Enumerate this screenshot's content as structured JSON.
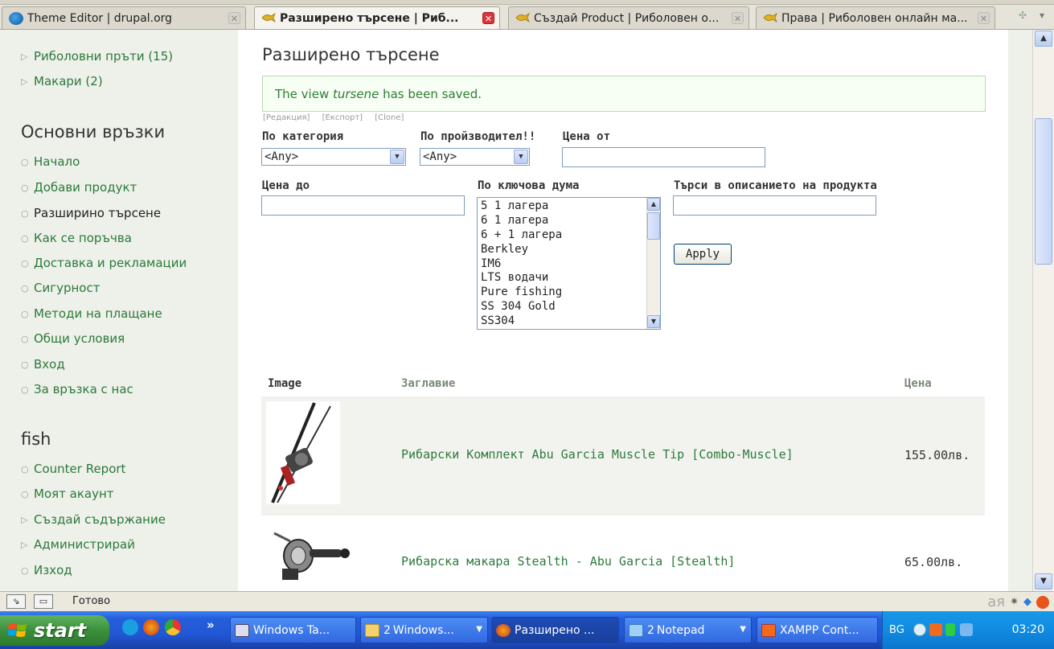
{
  "tabs": [
    {
      "label": "Theme Editor | drupal.org",
      "active": false
    },
    {
      "label": "Разширено търсене | Риб...",
      "active": true
    },
    {
      "label": "Създай Product | Риболовен о...",
      "active": false
    },
    {
      "label": "Права | Риболовен онлайн ма...",
      "active": false
    }
  ],
  "sidebar": {
    "top_items": [
      {
        "label": "Риболовни пръти (15)",
        "bullet": "▷"
      },
      {
        "label": "Макари (2)",
        "bullet": "▷"
      }
    ],
    "main_links_heading": "Основни връзки",
    "main_links": [
      {
        "label": "Начало",
        "active": false
      },
      {
        "label": "Добави продукт",
        "active": false
      },
      {
        "label": "Разширино търсене",
        "active": true
      },
      {
        "label": "Как се поръчва",
        "active": false
      },
      {
        "label": "Доставка и рекламации",
        "active": false
      },
      {
        "label": "Сигурност",
        "active": false
      },
      {
        "label": "Методи на плащане",
        "active": false
      },
      {
        "label": "Общи условия",
        "active": false
      },
      {
        "label": "Вход",
        "active": false
      },
      {
        "label": "За връзка с нас",
        "active": false
      }
    ],
    "user_heading": "fish",
    "user_links": [
      {
        "label": "Counter Report",
        "bullet": "○"
      },
      {
        "label": "Моят акаунт",
        "bullet": "○"
      },
      {
        "label": "Създай съдържание",
        "bullet": "▷"
      },
      {
        "label": "Администрирай",
        "bullet": "▷"
      },
      {
        "label": "Изход",
        "bullet": "○"
      }
    ]
  },
  "main": {
    "title": "Разширено търсене",
    "status_prefix": "The view ",
    "status_view": "tursene",
    "status_suffix": " has been saved.",
    "admin_links": [
      "[Редакция]",
      "[Експорт]",
      "[Clone]"
    ],
    "filters": {
      "category_label": "По категория",
      "category_value": "<Any>",
      "manufacturer_label": "По пройзводител!!",
      "manufacturer_value": "<Any>",
      "price_from_label": "Цена от",
      "price_from_value": "",
      "price_to_label": "Цена до",
      "price_to_value": "",
      "keyword_label": "По ключова дума",
      "keyword_options": [
        "5 1 лагера",
        "6 1 лагера",
        "6 + 1 лагера",
        "Berkley",
        "IM6",
        "LTS водачи",
        "Pure fishing",
        "SS 304 Gold",
        "SS304"
      ],
      "description_label": "Търси в описанието на продукта",
      "description_value": "",
      "apply_label": "Apply"
    },
    "table": {
      "headers": [
        "Image",
        "Заглавие",
        "Цена"
      ],
      "rows": [
        {
          "title": "Рибарски Комплект Abu Garcia Muscle Tip [Combo-Muscle]",
          "price": "155.00лв.",
          "image": "fishing-rod-combo"
        },
        {
          "title": "Рибарска макара Stealth - Abu Garcia [Stealth]",
          "price": "65.00лв.",
          "image": "fishing-reel"
        }
      ]
    }
  },
  "statusbar": {
    "text": "Готово",
    "ime": "aя"
  },
  "taskbar": {
    "start_label": "start",
    "tasks": [
      {
        "label": "Windows Ta...",
        "count": ""
      },
      {
        "label": "Windows...",
        "count": "2"
      },
      {
        "label": "Разширено ...",
        "count": ""
      },
      {
        "label": "Notepad",
        "count": "2"
      },
      {
        "label": "XAMPP Cont...",
        "count": ""
      }
    ],
    "lang": "BG",
    "clock": "03:20"
  },
  "colors": {
    "link_green": "#2b7a3b",
    "sidebar_bg": "#eef0ea",
    "xp_blue": "#245edb",
    "start_green": "#3c8f3c"
  }
}
